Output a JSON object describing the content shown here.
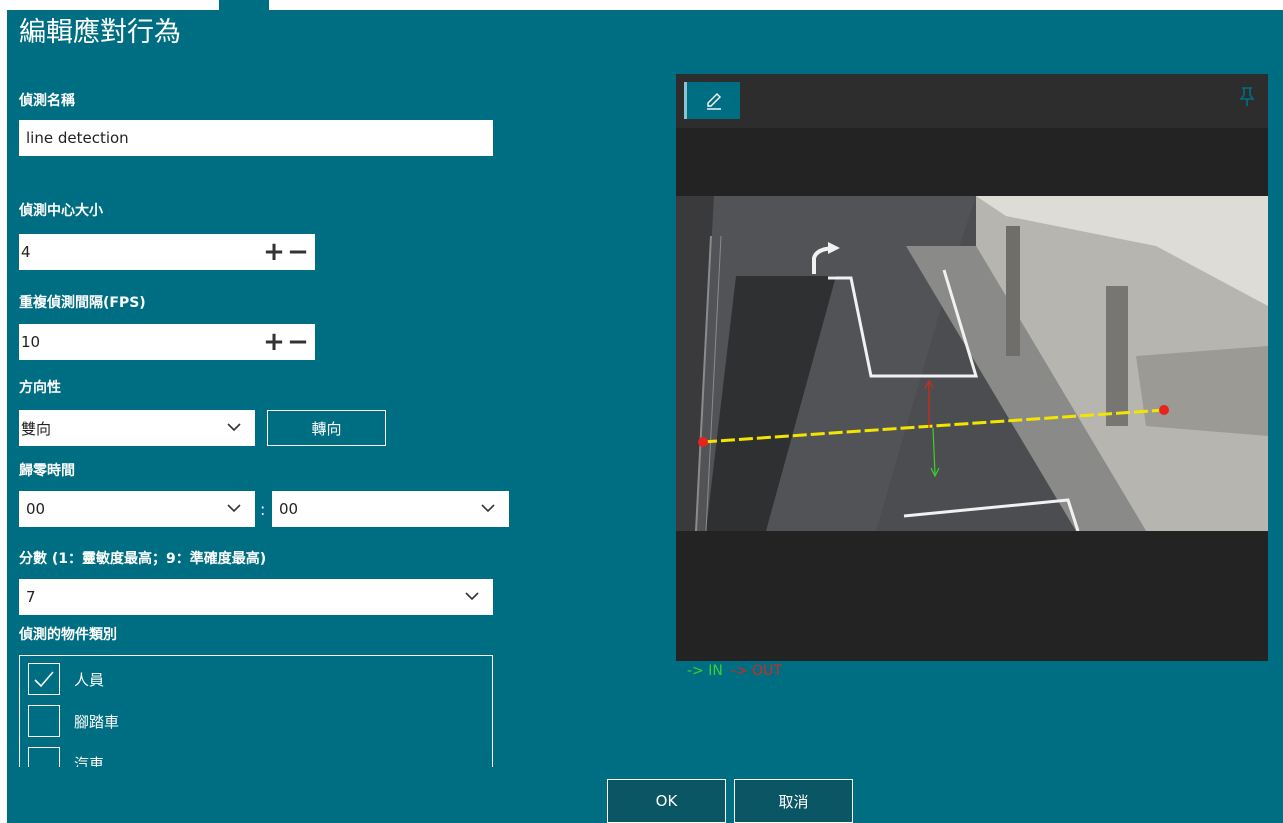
{
  "dialog": {
    "title": "編輯應對行為",
    "ok_label": "OK",
    "cancel_label": "取消"
  },
  "form": {
    "detection_name": {
      "label": "偵測名稱",
      "value": "line detection"
    },
    "center_size": {
      "label": "偵測中心大小",
      "value": "4",
      "increment": "+",
      "decrement": "−"
    },
    "repeat_interval": {
      "label": "重複偵測間隔(FPS)",
      "value": "10",
      "increment": "+",
      "decrement": "−"
    },
    "direction": {
      "label": "方向性",
      "value": "雙向",
      "reverse_label": "轉向"
    },
    "reset_time": {
      "label": "歸零時間",
      "hours": "00",
      "separator": ":",
      "minutes": "00"
    },
    "score": {
      "label": "分數 (1：靈敏度最高；9：準確度最高)",
      "value": "7"
    },
    "object_classes": {
      "label": "偵測的物件類別",
      "items": [
        {
          "label": "人員",
          "checked": true
        },
        {
          "label": "腳踏車",
          "checked": false
        },
        {
          "label": "汽車",
          "checked": false
        }
      ]
    }
  },
  "preview": {
    "toolbar": {
      "edit_icon": "pencil-icon",
      "pin_icon": "pin-icon"
    },
    "legend": {
      "in_label": "-> IN",
      "out_label": "-> OUT"
    }
  },
  "colors": {
    "dialog_bg": "#006e82",
    "preview_bg": "#232323",
    "line": "#f2e600",
    "endpoint": "#e8231b",
    "in_color": "#38d12d",
    "out_color": "#d9261c"
  }
}
